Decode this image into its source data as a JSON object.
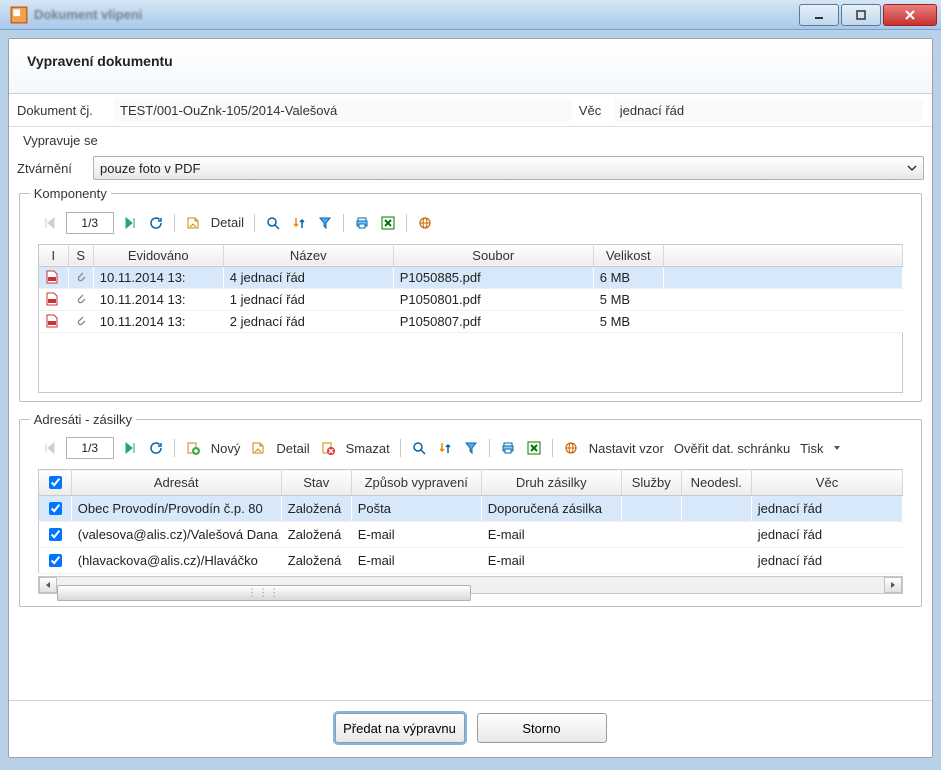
{
  "window": {
    "title_blurred": "Dokument vlipeni"
  },
  "header": {
    "title": "Vypravení dokumentu"
  },
  "doc": {
    "cj_label": "Dokument čj.",
    "cj_value": "TEST/001-OuZnk-105/2014-Valešová",
    "vec_label": "Věc",
    "vec_value": "jednací řád"
  },
  "vypravuje_label": "Vypravuje se",
  "ztvarneni": {
    "label": "Ztvárnění",
    "value": "pouze foto v PDF"
  },
  "komponenty": {
    "legend": "Komponenty",
    "pager": "1/3",
    "detail_label": "Detail",
    "columns": {
      "i": "I",
      "s": "S",
      "evidovano": "Evidováno",
      "nazev": "Název",
      "soubor": "Soubor",
      "velikost": "Velikost"
    },
    "rows": [
      {
        "evidovano": "10.11.2014 13:",
        "seq": "4",
        "nazev": "jednací řád",
        "soubor": "P1050885.pdf",
        "velikost": "6 MB"
      },
      {
        "evidovano": "10.11.2014 13:",
        "seq": "1",
        "nazev": "jednací řád",
        "soubor": "P1050801.pdf",
        "velikost": "5 MB"
      },
      {
        "evidovano": "10.11.2014 13:",
        "seq": "2",
        "nazev": "jednací řád",
        "soubor": "P1050807.pdf",
        "velikost": "5 MB"
      }
    ]
  },
  "adresati": {
    "legend": "Adresáti - zásilky",
    "pager": "1/3",
    "novy_label": "Nový",
    "detail_label": "Detail",
    "smazat_label": "Smazat",
    "nastavit_label": "Nastavit vzor",
    "overit_label": "Ověřit dat. schránku",
    "tisk_label": "Tisk",
    "columns": {
      "check": "☑",
      "adresat": "Adresát",
      "stav": "Stav",
      "zpusob": "Způsob vypravení",
      "druh": "Druh zásilky",
      "sluzby": "Služby",
      "neodesl": "Neodesl.",
      "vec": "Věc"
    },
    "rows": [
      {
        "checked": true,
        "adresat": "Obec Provodín/Provodín č.p. 80",
        "stav": "Založená",
        "zpusob": "Pošta",
        "druh": "Doporučená zásilka",
        "sluzby": "",
        "neodesl": "",
        "vec": "jednací řád"
      },
      {
        "checked": true,
        "adresat": "(valesova@alis.cz)/Valešová Dana",
        "stav": "Založená",
        "zpusob": "E-mail",
        "druh": "E-mail",
        "sluzby": "",
        "neodesl": "",
        "vec": "jednací řád"
      },
      {
        "checked": true,
        "adresat": "(hlavackova@alis.cz)/Hlaváčko",
        "stav": "Založená",
        "zpusob": "E-mail",
        "druh": "E-mail",
        "sluzby": "",
        "neodesl": "",
        "vec": "jednací řád"
      }
    ]
  },
  "footer": {
    "submit": "Předat na výpravnu",
    "cancel": "Storno"
  }
}
